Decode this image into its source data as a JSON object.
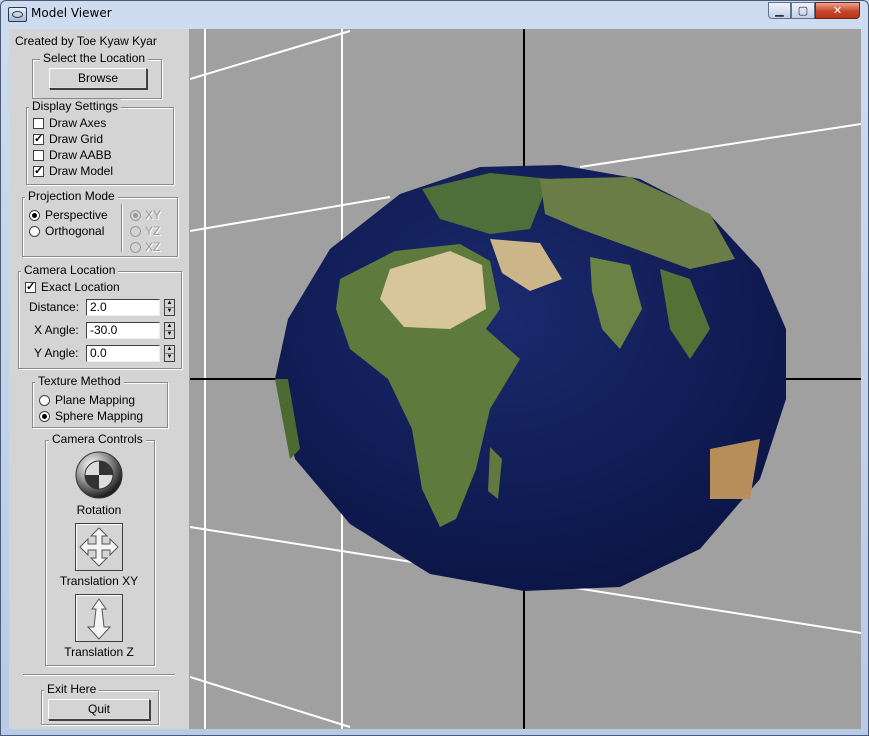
{
  "window": {
    "title": "Model Viewer"
  },
  "panel": {
    "credit": "Created by Toe Kyaw Kyar",
    "location": {
      "title": "Select the Location",
      "browse": "Browse"
    },
    "display": {
      "title": "Display Settings",
      "draw_axes": {
        "label": "Draw Axes",
        "checked": false
      },
      "draw_grid": {
        "label": "Draw Grid",
        "checked": true
      },
      "draw_aabb": {
        "label": "Draw AABB",
        "checked": false
      },
      "draw_model": {
        "label": "Draw Model",
        "checked": true
      }
    },
    "projection": {
      "title": "Projection Mode",
      "perspective": "Perspective",
      "orthogonal": "Orthogonal",
      "selected": "Perspective",
      "planes": [
        "XY",
        "YZ",
        "XZ"
      ],
      "selected_plane": "XY"
    },
    "camera": {
      "title": "Camera Location",
      "exact": {
        "label": "Exact Location",
        "checked": true
      },
      "distance_label": "Distance:",
      "distance": "2.0",
      "xangle_label": "X Angle:",
      "xangle": "-30.0",
      "yangle_label": "Y Angle:",
      "yangle": "0.0"
    },
    "texture": {
      "title": "Texture Method",
      "plane": "Plane Mapping",
      "sphere": "Sphere Mapping",
      "selected": "Sphere Mapping"
    },
    "controls": {
      "title": "Camera Controls",
      "rotation": "Rotation",
      "translation_xy": "Translation XY",
      "translation_z": "Translation Z"
    },
    "exit": {
      "title": "Exit Here",
      "quit": "Quit"
    }
  },
  "viewport": {
    "model": "textured earth globe",
    "background_color": "#a0a0a0",
    "grid_color": "#ffffff",
    "axes_color": "#000000",
    "ocean_color": "#0f1a52"
  }
}
